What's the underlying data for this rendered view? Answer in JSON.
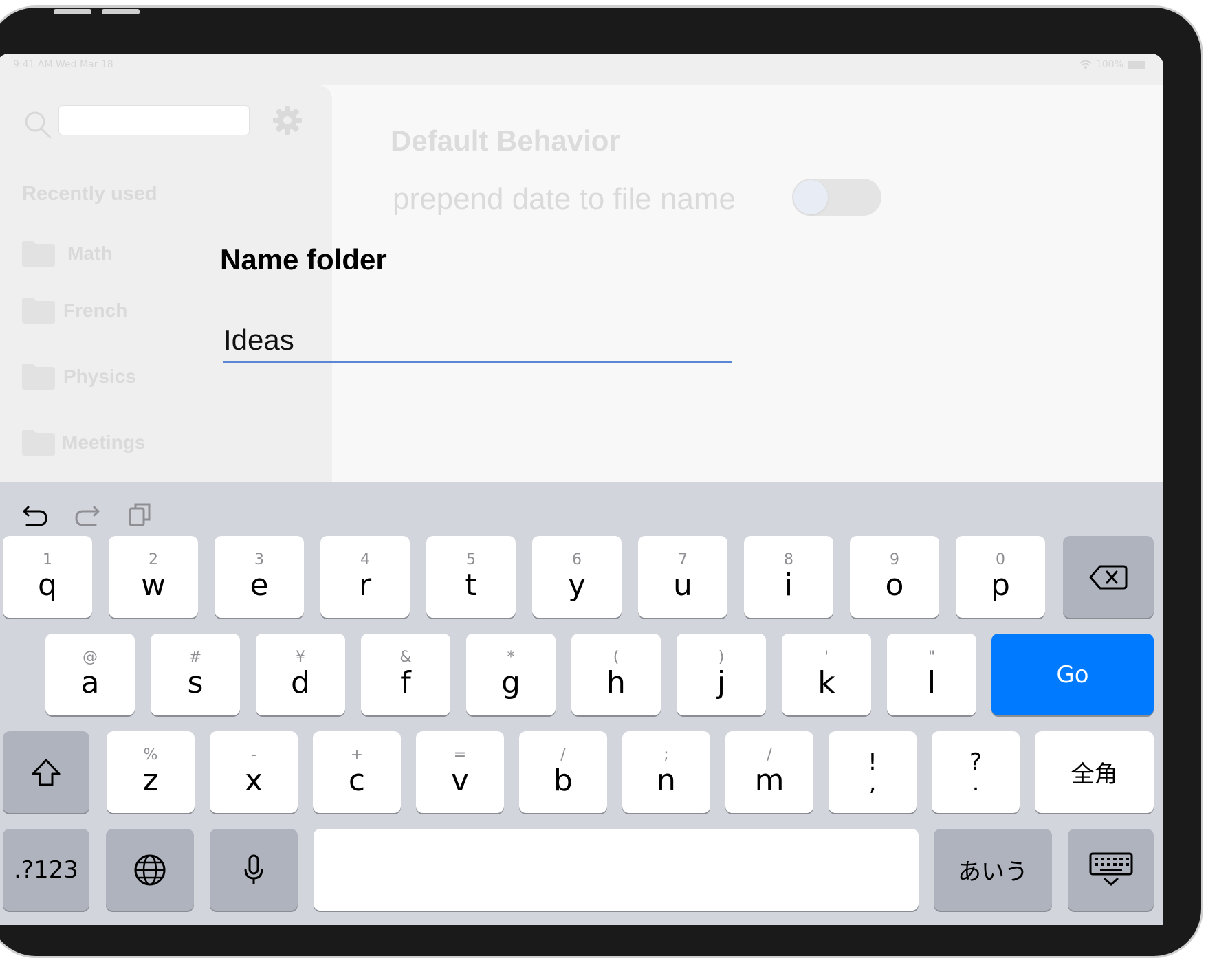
{
  "status_bar": {
    "time": "9:41 AM  Wed Mar 18",
    "battery_text": "100%"
  },
  "sidebar": {
    "search_placeholder": "",
    "recently_used_label": "Recently used",
    "folders": [
      {
        "label": "Math"
      },
      {
        "label": "French"
      },
      {
        "label": "Physics"
      },
      {
        "label": "Meetings"
      }
    ]
  },
  "settings": {
    "title": "Default Behavior",
    "prepend_date_label": "prepend date to file name",
    "prepend_date_on": false
  },
  "dialog": {
    "title": "Name folder",
    "input_value": "Ideas"
  },
  "keyboard": {
    "row1": [
      {
        "alt": "1",
        "main": "q"
      },
      {
        "alt": "2",
        "main": "w"
      },
      {
        "alt": "3",
        "main": "e"
      },
      {
        "alt": "4",
        "main": "r"
      },
      {
        "alt": "5",
        "main": "t"
      },
      {
        "alt": "6",
        "main": "y"
      },
      {
        "alt": "7",
        "main": "u"
      },
      {
        "alt": "8",
        "main": "i"
      },
      {
        "alt": "9",
        "main": "o"
      },
      {
        "alt": "0",
        "main": "p"
      }
    ],
    "row2": [
      {
        "alt": "@",
        "main": "a"
      },
      {
        "alt": "#",
        "main": "s"
      },
      {
        "alt": "¥",
        "main": "d"
      },
      {
        "alt": "&",
        "main": "f"
      },
      {
        "alt": "*",
        "main": "g"
      },
      {
        "alt": "(",
        "main": "h"
      },
      {
        "alt": ")",
        "main": "j"
      },
      {
        "alt": "'",
        "main": "k"
      },
      {
        "alt": "\"",
        "main": "l"
      }
    ],
    "row3": [
      {
        "alt": "%",
        "main": "z"
      },
      {
        "alt": "-",
        "main": "x"
      },
      {
        "alt": "+",
        "main": "c"
      },
      {
        "alt": "=",
        "main": "v"
      },
      {
        "alt": "/",
        "main": "b"
      },
      {
        "alt": ";",
        "main": "n"
      },
      {
        "alt": "/",
        "main": "m"
      }
    ],
    "punct1": {
      "top": "!",
      "bottom": ","
    },
    "punct2": {
      "top": "?",
      "bottom": "."
    },
    "go_label": "Go",
    "zenkaku_label": "全角",
    "numbers_label": ".?123",
    "kana_label": "あいう",
    "space_label": ""
  }
}
